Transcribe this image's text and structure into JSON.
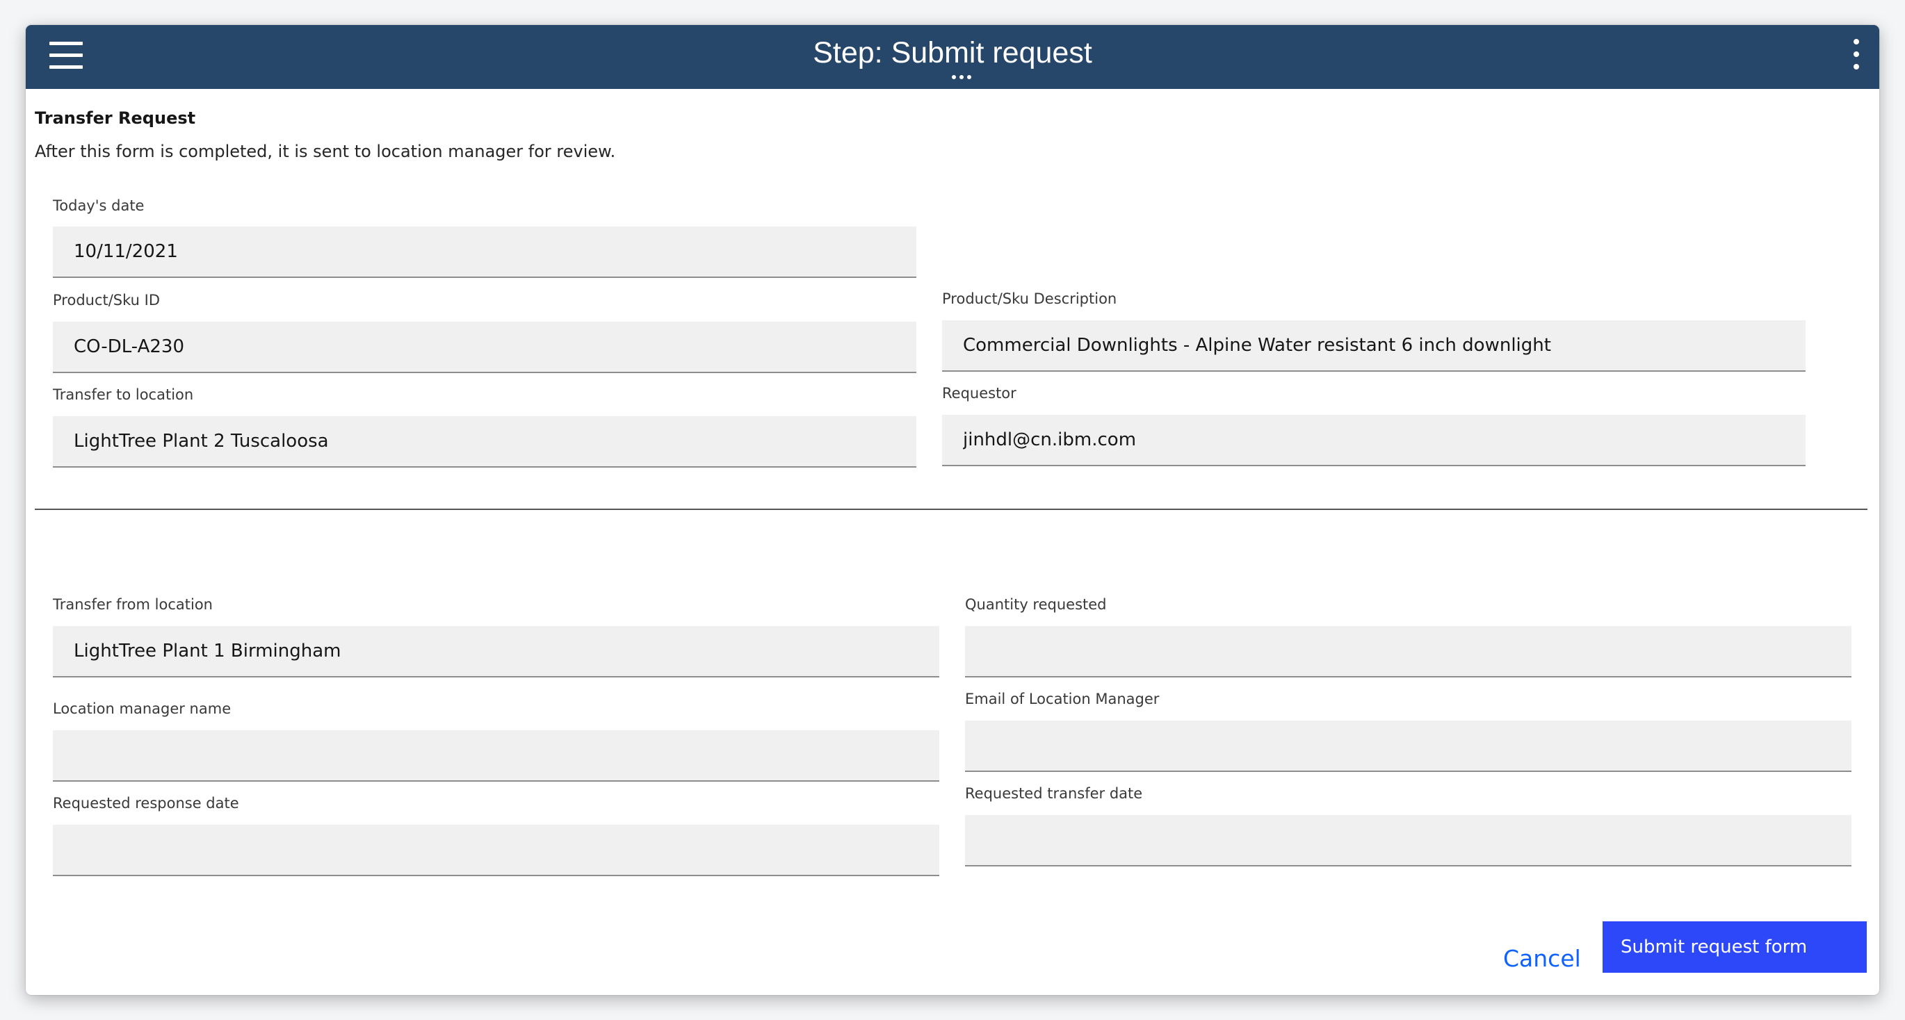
{
  "header": {
    "title": "Step: Submit request"
  },
  "form": {
    "title": "Transfer Request",
    "description": "After this form is completed, it is sent to location manager for review."
  },
  "fields": {
    "todays_date": {
      "label": "Today's date",
      "value": "10/11/2021"
    },
    "product_sku_id": {
      "label": "Product/Sku ID",
      "value": "CO-DL-A230"
    },
    "product_sku_description": {
      "label": "Product/Sku Description",
      "value": "Commercial Downlights - Alpine Water resistant 6 inch downlight"
    },
    "transfer_to_location": {
      "label": "Transfer to location",
      "value": "LightTree Plant 2 Tuscaloosa"
    },
    "requestor": {
      "label": "Requestor",
      "value": "jinhdl@cn.ibm.com"
    },
    "transfer_from_location": {
      "label": "Transfer from location",
      "value": "LightTree Plant 1 Birmingham"
    },
    "quantity_requested": {
      "label": "Quantity requested",
      "value": ""
    },
    "location_manager_name": {
      "label": "Location manager name",
      "value": ""
    },
    "email_location_manager": {
      "label": "Email of Location Manager",
      "value": ""
    },
    "requested_response_date": {
      "label": "Requested response date",
      "value": ""
    },
    "requested_transfer_date": {
      "label": "Requested transfer date",
      "value": ""
    }
  },
  "actions": {
    "cancel_label": "Cancel",
    "submit_label": "Submit request form"
  },
  "colors": {
    "header_bg": "#264769",
    "primary_button": "#2d48f9",
    "link": "#0f62fe",
    "field_bg": "#f0f0f0"
  },
  "icons": {
    "menu": "hamburger-menu-icon",
    "title_more": "more-horizontal-icon",
    "overflow": "more-vertical-icon"
  }
}
